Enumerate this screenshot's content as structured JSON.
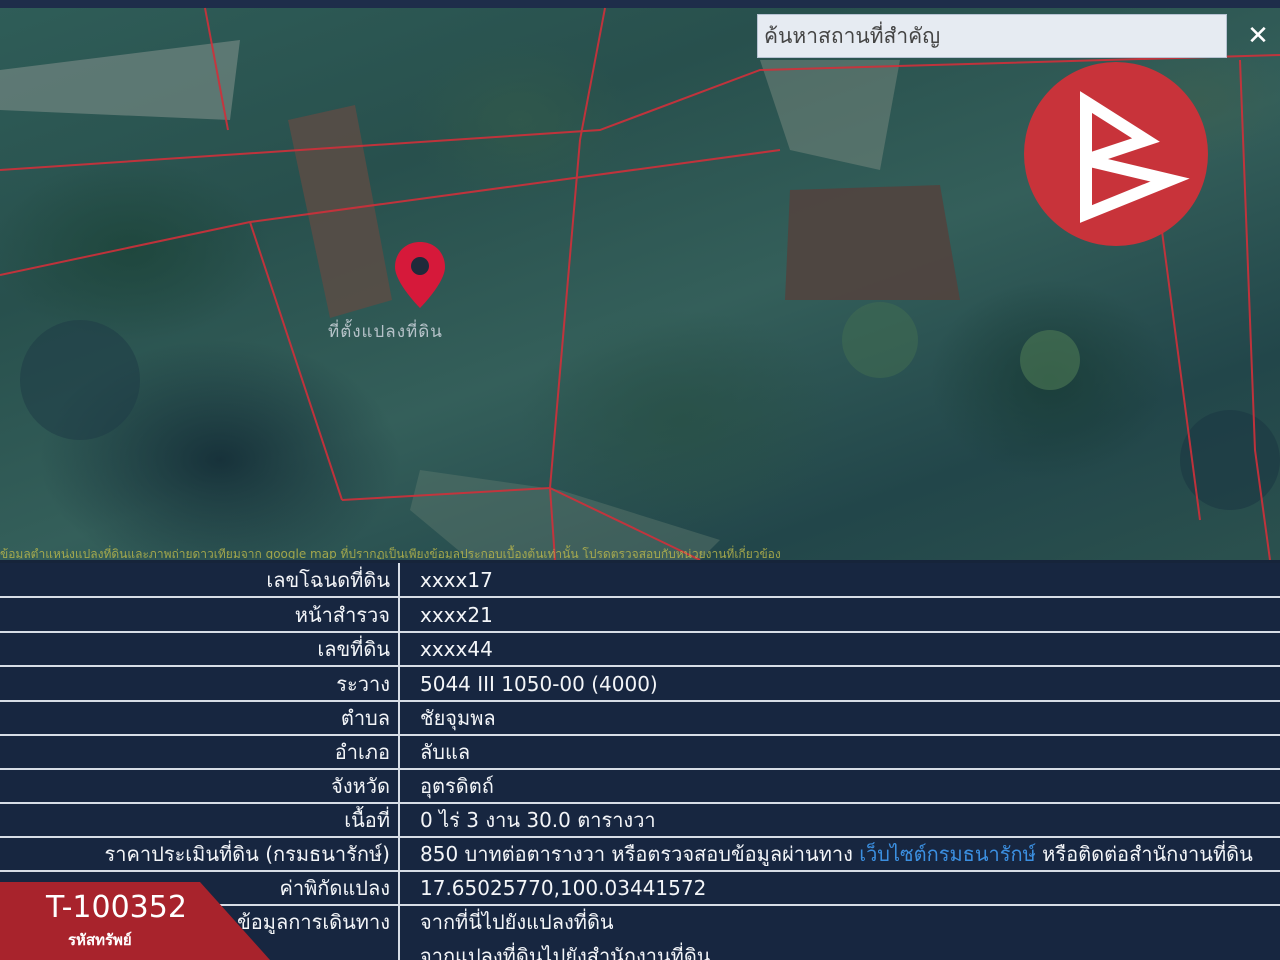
{
  "search": {
    "placeholder": "ค้นหาสถานที่สำคัญ",
    "close_icon": "close-icon"
  },
  "map": {
    "pin_icon": "map-pin-icon",
    "pin_label": "ที่ตั้งแปลงที่ดิน",
    "logo_icon": "brand-logo-icon",
    "disclaimer": "ข้อมูลตำแหน่งแปลงที่ดินและภาพถ่ายดาวเทียมจาก google map ที่ปรากฏเป็นเพียงข้อมูลประกอบเบื้องต้นเท่านั้น โปรดตรวจสอบกับหน่วยงานที่เกี่ยวข้อง"
  },
  "info": {
    "rows": [
      {
        "label": "เลขโฉนดที่ดิน",
        "value": "xxxx17"
      },
      {
        "label": "หน้าสำรวจ",
        "value": "xxxx21"
      },
      {
        "label": "เลขที่ดิน",
        "value": "xxxx44"
      },
      {
        "label": "ระวาง",
        "value": "5044 III 1050-00 (4000)"
      },
      {
        "label": "ตำบล",
        "value": "ชัยจุมพล"
      },
      {
        "label": "อำเภอ",
        "value": "ลับแล"
      },
      {
        "label": "จังหวัด",
        "value": "อุตรดิตถ์"
      },
      {
        "label": "เนื้อที่",
        "value": "0 ไร่ 3 งาน 30.0 ตารางวา"
      }
    ],
    "price": {
      "label": "ราคาประเมินที่ดิน (กรมธนารักษ์)",
      "text1": "850 บาทต่อตารางวา หรือตรวจสอบข้อมูลผ่านทาง",
      "link": "เว็บไซต์กรมธนารักษ์",
      "text2": "หรือติดต่อสำนักงานที่ดิน"
    },
    "coords": {
      "label": "ค่าพิกัดแปลง",
      "value": "17.65025770,100.03441572"
    },
    "travel": {
      "label": "ข้อมูลการเดินทาง",
      "link1": "จากที่นี่ไปยังแปลงที่ดิน",
      "link2": "จากแปลงที่ดินไปยังสำนักงานที่ดิน"
    }
  },
  "badge": {
    "code": "T-100352",
    "label": "รหัสทรัพย์"
  },
  "colors": {
    "accent": "#c8333a",
    "link": "#3b8fe0",
    "panel": "#172640",
    "parcel_line": "#d0303a"
  }
}
